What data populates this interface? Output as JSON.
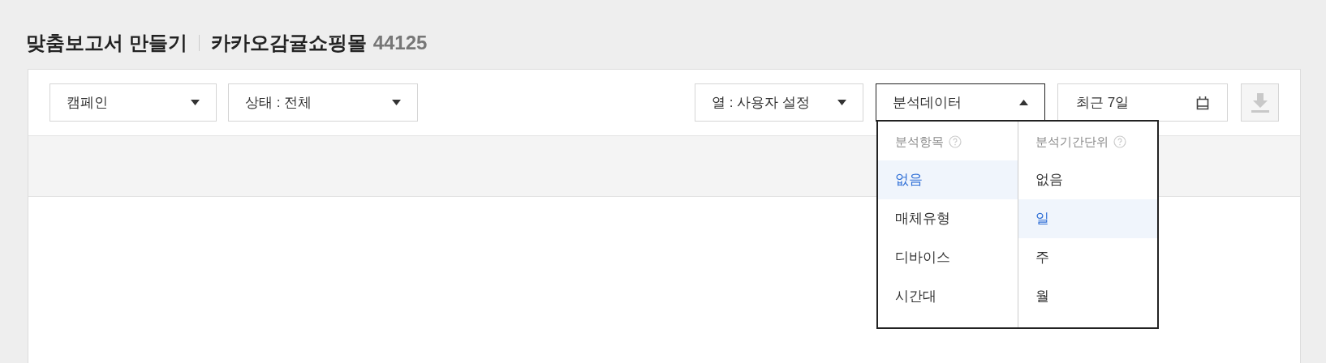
{
  "page_title": "맞춤보고서 만들기",
  "account": {
    "name": "카카오감귤쇼핑몰",
    "id": "44125"
  },
  "toolbar": {
    "campaign_select": {
      "value": "캠페인"
    },
    "status_select": {
      "value": "상태 : 전체"
    },
    "column_select": {
      "value": "열 : 사용자 설정"
    },
    "analysis_select": {
      "value": "분석데이터",
      "expanded": true
    },
    "date_field": {
      "value": "최근 7일"
    },
    "download_button": {
      "disabled": true
    }
  },
  "analysis_menu": {
    "columns": [
      {
        "title": "분석항목",
        "items": [
          {
            "label": "없음",
            "selected": true
          },
          {
            "label": "매체유형",
            "selected": false
          },
          {
            "label": "디바이스",
            "selected": false
          },
          {
            "label": "시간대",
            "selected": false
          }
        ]
      },
      {
        "title": "분석기간단위",
        "items": [
          {
            "label": "없음",
            "selected": false
          },
          {
            "label": "일",
            "selected": true
          },
          {
            "label": "주",
            "selected": false
          },
          {
            "label": "월",
            "selected": false
          }
        ]
      }
    ]
  }
}
